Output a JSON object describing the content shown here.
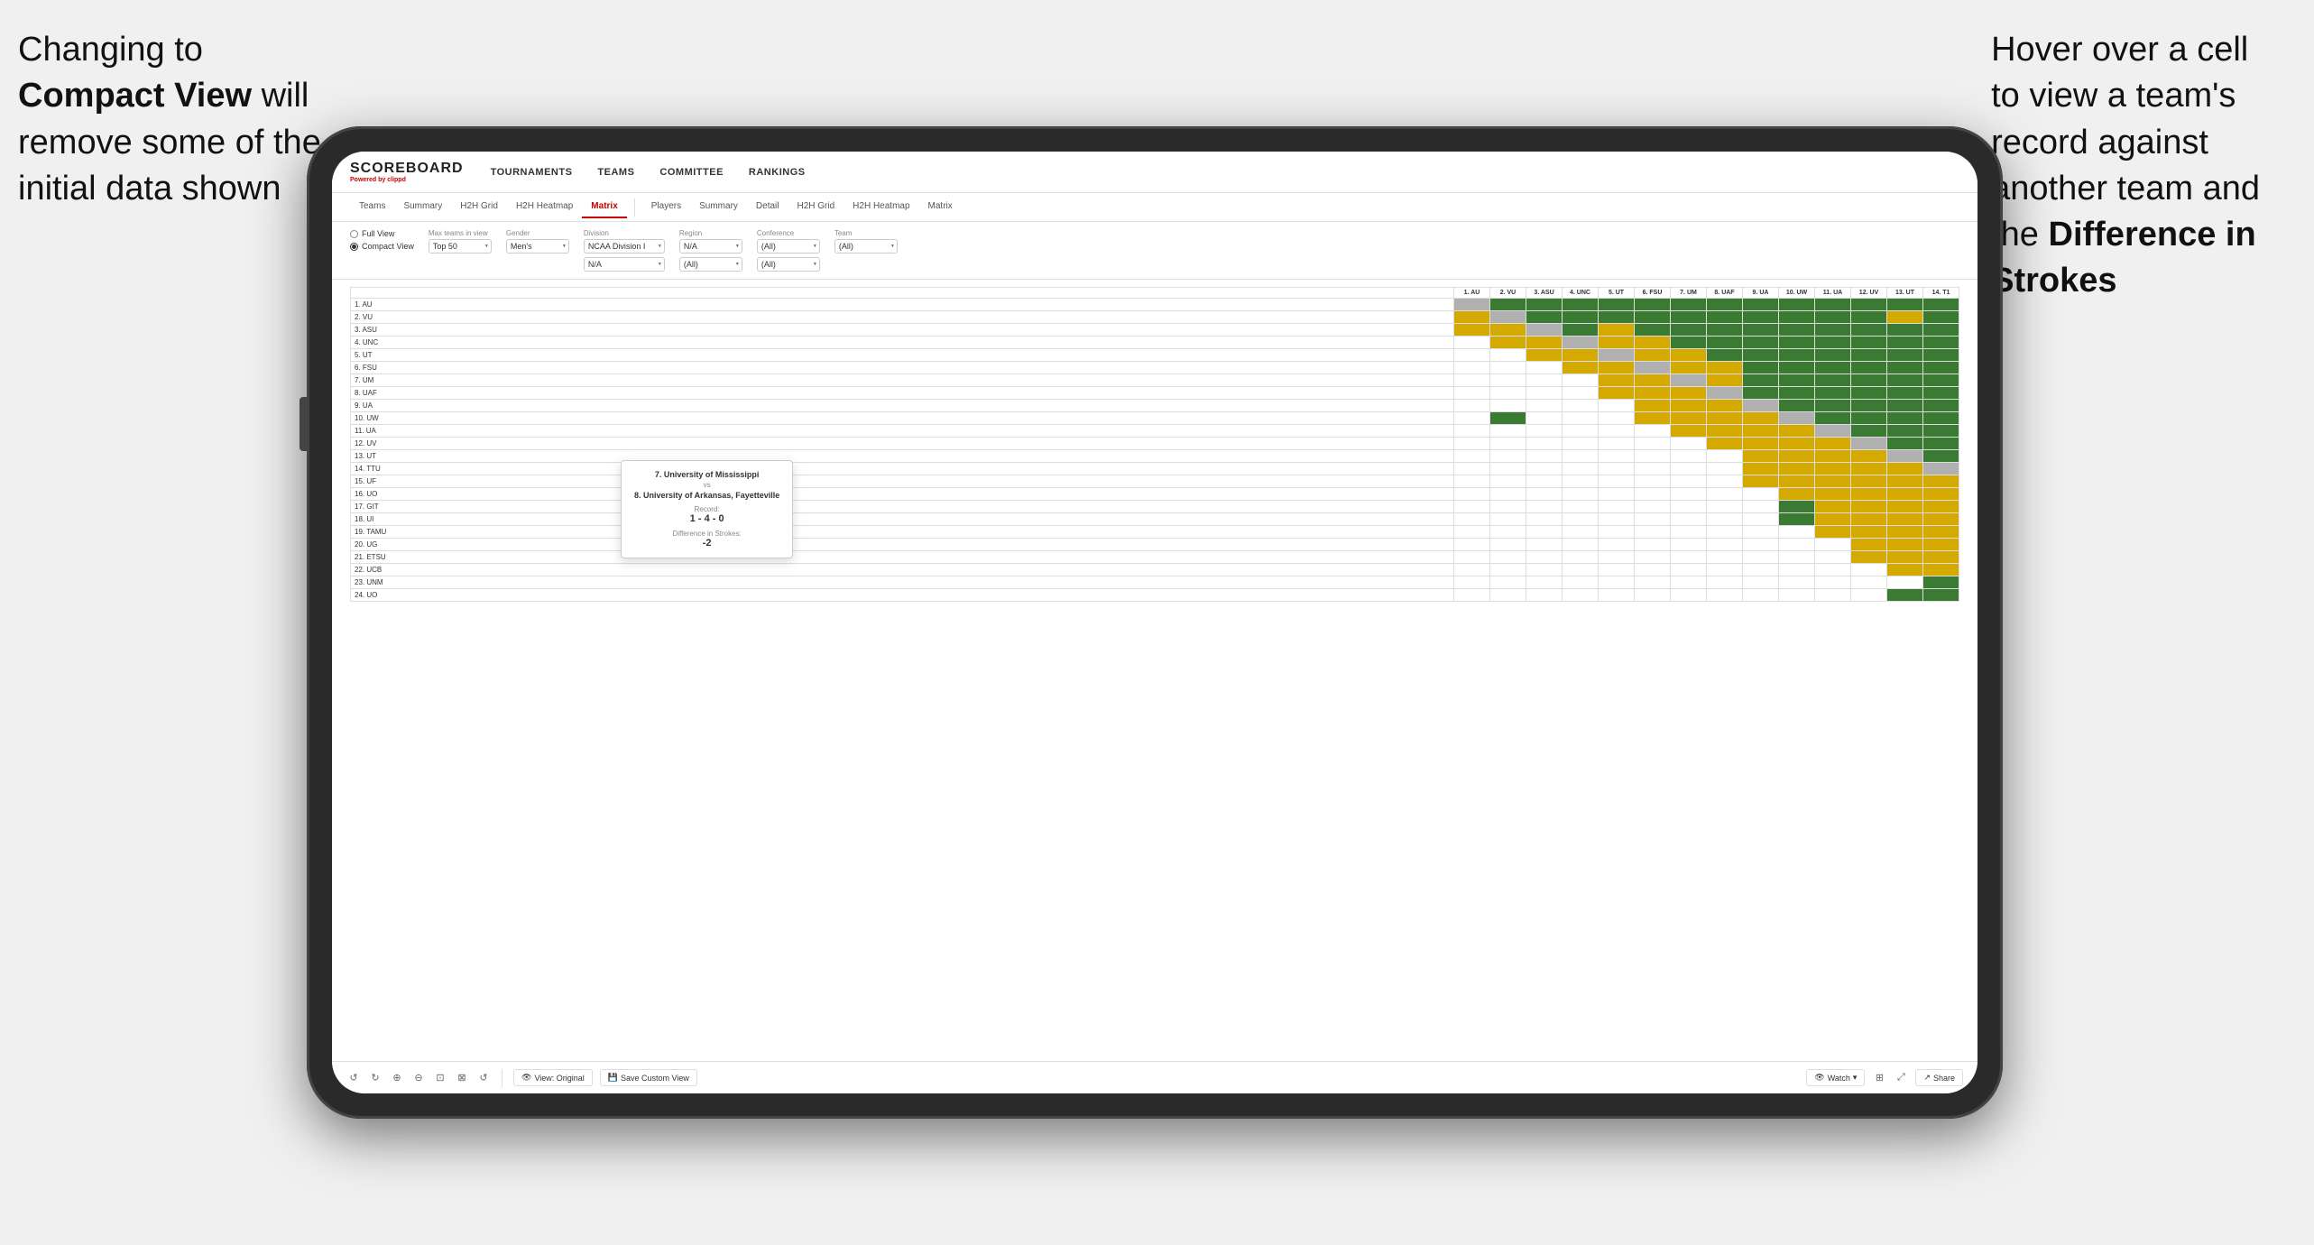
{
  "annotation_left": {
    "line1": "Changing to",
    "line2_bold": "Compact View",
    "line2_rest": " will",
    "line3": "remove some of the",
    "line4": "initial data shown"
  },
  "annotation_right": {
    "line1": "Hover over a cell",
    "line2": "to view a team's",
    "line3": "record against",
    "line4": "another team and",
    "line5_pre": "the ",
    "line5_bold": "Difference in",
    "line6_bold": "Strokes"
  },
  "app": {
    "logo": "SCOREBOARD",
    "logo_sub_pre": "Powered by ",
    "logo_sub_brand": "clippd",
    "nav": [
      "TOURNAMENTS",
      "TEAMS",
      "COMMITTEE",
      "RANKINGS"
    ],
    "sub_nav_left": [
      "Teams",
      "Summary",
      "H2H Grid",
      "H2H Heatmap",
      "Matrix"
    ],
    "sub_nav_right": [
      "Players",
      "Summary",
      "Detail",
      "H2H Grid",
      "H2H Heatmap",
      "Matrix"
    ],
    "active_tab": "Matrix",
    "filters": {
      "view_full": "Full View",
      "view_compact": "Compact View",
      "compact_selected": true,
      "max_teams_label": "Max teams in view",
      "max_teams_value": "Top 50",
      "gender_label": "Gender",
      "gender_value": "Men's",
      "division_label": "Division",
      "division_value": "NCAA Division I",
      "region_label": "Region",
      "region_value": "N/A",
      "conference_label": "Conference",
      "conference_value": "(All)",
      "team_label": "Team",
      "team_value": "(All)"
    },
    "col_headers": [
      "1. AU",
      "2. VU",
      "3. ASU",
      "4. UNC",
      "5. UT",
      "6. FSU",
      "7. UM",
      "8. UAF",
      "9. UA",
      "10. UW",
      "11. UA",
      "12. UV",
      "13. UT",
      "14. T1"
    ],
    "rows": [
      {
        "label": "1. AU",
        "cells": [
          "x",
          "g",
          "g",
          "g",
          "g",
          "g",
          "g",
          "g",
          "g",
          "g",
          "g",
          "g",
          "g",
          "g"
        ]
      },
      {
        "label": "2. VU",
        "cells": [
          "y",
          "x",
          "g",
          "g",
          "g",
          "g",
          "g",
          "g",
          "g",
          "g",
          "g",
          "g",
          "y",
          "g"
        ]
      },
      {
        "label": "3. ASU",
        "cells": [
          "y",
          "y",
          "x",
          "g",
          "y",
          "g",
          "g",
          "g",
          "g",
          "g",
          "g",
          "g",
          "g",
          "g"
        ]
      },
      {
        "label": "4. UNC",
        "cells": [
          "w",
          "y",
          "y",
          "x",
          "y",
          "y",
          "g",
          "g",
          "g",
          "g",
          "g",
          "g",
          "g",
          "g"
        ]
      },
      {
        "label": "5. UT",
        "cells": [
          "w",
          "w",
          "y",
          "y",
          "x",
          "y",
          "y",
          "g",
          "g",
          "g",
          "g",
          "g",
          "g",
          "g"
        ]
      },
      {
        "label": "6. FSU",
        "cells": [
          "w",
          "w",
          "w",
          "y",
          "y",
          "x",
          "y",
          "y",
          "g",
          "g",
          "g",
          "g",
          "g",
          "g"
        ]
      },
      {
        "label": "7. UM",
        "cells": [
          "w",
          "w",
          "w",
          "w",
          "y",
          "y",
          "x",
          "y",
          "g",
          "g",
          "g",
          "g",
          "g",
          "g"
        ]
      },
      {
        "label": "8. UAF",
        "cells": [
          "w",
          "w",
          "w",
          "w",
          "y",
          "y",
          "y",
          "x",
          "g",
          "g",
          "g",
          "g",
          "g",
          "g"
        ]
      },
      {
        "label": "9. UA",
        "cells": [
          "w",
          "w",
          "w",
          "w",
          "w",
          "y",
          "y",
          "y",
          "x",
          "g",
          "g",
          "g",
          "g",
          "g"
        ]
      },
      {
        "label": "10. UW",
        "cells": [
          "w",
          "g",
          "w",
          "w",
          "w",
          "y",
          "y",
          "y",
          "y",
          "x",
          "g",
          "g",
          "g",
          "g"
        ]
      },
      {
        "label": "11. UA",
        "cells": [
          "w",
          "w",
          "w",
          "w",
          "w",
          "w",
          "y",
          "y",
          "y",
          "y",
          "x",
          "g",
          "g",
          "g"
        ]
      },
      {
        "label": "12. UV",
        "cells": [
          "w",
          "w",
          "w",
          "w",
          "w",
          "w",
          "w",
          "y",
          "y",
          "y",
          "y",
          "x",
          "g",
          "g"
        ]
      },
      {
        "label": "13. UT",
        "cells": [
          "w",
          "w",
          "w",
          "w",
          "w",
          "w",
          "w",
          "w",
          "y",
          "y",
          "y",
          "y",
          "x",
          "g"
        ]
      },
      {
        "label": "14. TTU",
        "cells": [
          "w",
          "w",
          "w",
          "w",
          "w",
          "w",
          "w",
          "w",
          "y",
          "y",
          "y",
          "y",
          "y",
          "x"
        ]
      },
      {
        "label": "15. UF",
        "cells": [
          "w",
          "w",
          "w",
          "w",
          "w",
          "w",
          "w",
          "w",
          "y",
          "y",
          "y",
          "y",
          "y",
          "y"
        ]
      },
      {
        "label": "16. UO",
        "cells": [
          "w",
          "w",
          "w",
          "w",
          "w",
          "w",
          "w",
          "w",
          "w",
          "y",
          "y",
          "y",
          "y",
          "y"
        ]
      },
      {
        "label": "17. GIT",
        "cells": [
          "w",
          "w",
          "w",
          "w",
          "w",
          "w",
          "w",
          "w",
          "w",
          "g",
          "y",
          "y",
          "y",
          "y"
        ]
      },
      {
        "label": "18. UI",
        "cells": [
          "w",
          "w",
          "w",
          "w",
          "w",
          "w",
          "w",
          "w",
          "w",
          "g",
          "y",
          "y",
          "y",
          "y"
        ]
      },
      {
        "label": "19. TAMU",
        "cells": [
          "w",
          "w",
          "w",
          "w",
          "w",
          "w",
          "w",
          "w",
          "w",
          "w",
          "y",
          "y",
          "y",
          "y"
        ]
      },
      {
        "label": "20. UG",
        "cells": [
          "w",
          "w",
          "w",
          "w",
          "w",
          "w",
          "w",
          "w",
          "w",
          "w",
          "w",
          "y",
          "y",
          "y"
        ]
      },
      {
        "label": "21. ETSU",
        "cells": [
          "w",
          "w",
          "w",
          "w",
          "w",
          "w",
          "w",
          "w",
          "w",
          "w",
          "w",
          "y",
          "y",
          "y"
        ]
      },
      {
        "label": "22. UCB",
        "cells": [
          "w",
          "w",
          "w",
          "w",
          "w",
          "w",
          "w",
          "w",
          "w",
          "w",
          "w",
          "w",
          "y",
          "y"
        ]
      },
      {
        "label": "23. UNM",
        "cells": [
          "w",
          "w",
          "w",
          "w",
          "w",
          "w",
          "w",
          "w",
          "w",
          "w",
          "w",
          "w",
          "w",
          "g"
        ]
      },
      {
        "label": "24. UO",
        "cells": [
          "w",
          "w",
          "w",
          "w",
          "w",
          "w",
          "w",
          "w",
          "w",
          "w",
          "w",
          "w",
          "g",
          "g"
        ]
      }
    ],
    "tooltip": {
      "team1": "7. University of Mississippi",
      "vs": "vs",
      "team2": "8. University of Arkansas, Fayetteville",
      "record_label": "Record:",
      "record": "1 - 4 - 0",
      "diff_label": "Difference in Strokes:",
      "diff": "-2"
    },
    "toolbar": {
      "view_original": "View: Original",
      "save_custom": "Save Custom View",
      "watch": "Watch",
      "share": "Share"
    }
  }
}
